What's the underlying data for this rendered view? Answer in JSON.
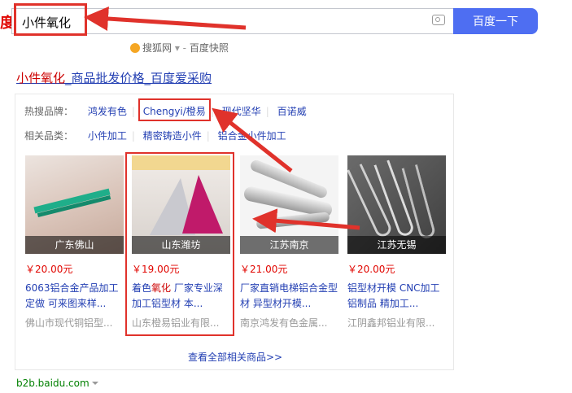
{
  "search": {
    "logo_fragment": "度",
    "query": "小件氧化",
    "button_label": "百度一下"
  },
  "above": {
    "source": "搜狐网",
    "link": "百度快照"
  },
  "result": {
    "title_em": "小件氧化",
    "title_rest": "_商品批发价格_百度爱采购",
    "brands_label": "热搜品牌：",
    "brands": [
      "鸿发有色",
      "Chengyi/橙易",
      "现代坚华",
      "百诺威"
    ],
    "related_label": "相关品类：",
    "related": [
      "小件加工",
      "精密铸造小件",
      "铝合金小件加工"
    ],
    "products": [
      {
        "location": "广东佛山",
        "price": "￥20.00元",
        "title_a": "6063铝合金产品加工定做 可来图来样...",
        "title_em": "",
        "title_b": "",
        "shop": "佛山市现代铜铝型..."
      },
      {
        "location": "山东潍坊",
        "price": "￥19.00元",
        "title_a": "着色",
        "title_em": "氧化",
        "title_b": " 厂家专业深加工铝型材 本...",
        "shop": "山东橙易铝业有限..."
      },
      {
        "location": "江苏南京",
        "price": "￥21.00元",
        "title_a": "厂家直销电梯铝合金型材 异型材开模...",
        "title_em": "",
        "title_b": "",
        "shop": "南京鸿发有色金属..."
      },
      {
        "location": "江苏无锡",
        "price": "￥20.00元",
        "title_a": "铝型材开模 CNC加工 铝制品 精加工...",
        "title_em": "",
        "title_b": "",
        "shop": "江阴鑫邦铝业有限..."
      }
    ],
    "more": "查看全部相关商品>>",
    "site": "b2b.baidu.com"
  },
  "colors": {
    "accent": "#4e6ef2",
    "link": "#2440b3",
    "highlight": "#e10601",
    "annotation": "#e0322b"
  }
}
